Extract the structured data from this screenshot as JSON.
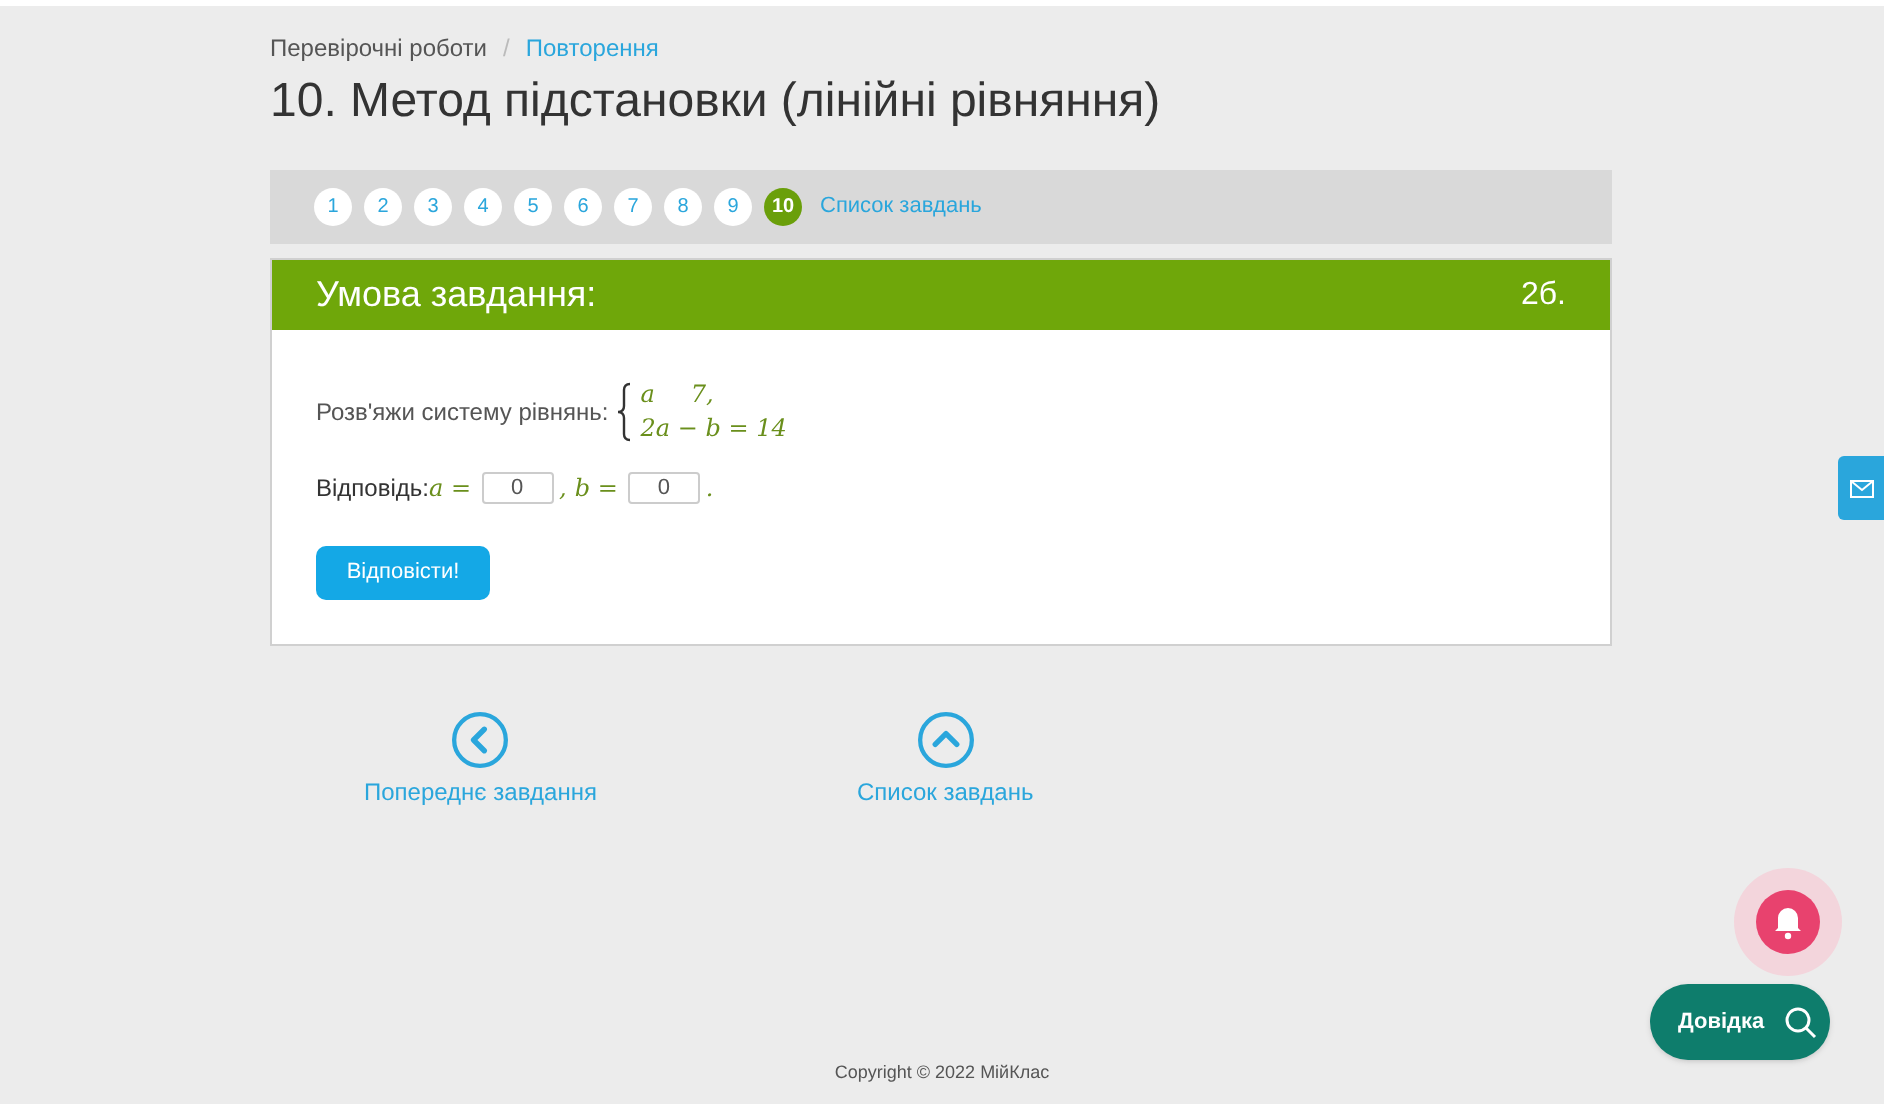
{
  "breadcrumb_separator": "/",
  "breadcrumbs": [
    {
      "label": "Перевірочні роботи",
      "link": false
    },
    {
      "label": "Повторення",
      "link": true
    }
  ],
  "title": "10. Метод підстановки (лінійні рівняння)",
  "pager": {
    "items": [
      {
        "label": "1",
        "selected": false
      },
      {
        "label": "2",
        "selected": false
      },
      {
        "label": "3",
        "selected": false
      },
      {
        "label": "4",
        "selected": false
      },
      {
        "label": "5",
        "selected": false
      },
      {
        "label": "6",
        "selected": false
      },
      {
        "label": "7",
        "selected": false
      },
      {
        "label": "8",
        "selected": false
      },
      {
        "label": "9",
        "selected": false
      },
      {
        "label": "10",
        "selected": true
      }
    ],
    "list_link": "Список завдань"
  },
  "task": {
    "header": "Умова завдання:",
    "points": "2б.",
    "prompt": "Розв'яжи систему рівнянь:",
    "system": [
      [
        "a",
        "7,"
      ],
      [
        "2a − b = 14"
      ]
    ],
    "answer_label": "Відповідь:",
    "answer": [
      {
        "var": "a =",
        "value": "0",
        "after": ","
      },
      {
        "var": "b =",
        "value": "0",
        "after": "."
      }
    ],
    "submit": "Відповісти!"
  },
  "nav": [
    {
      "kind": "previous",
      "label": "Попереднє завдання"
    },
    {
      "kind": "list",
      "label": "Список завдань"
    }
  ],
  "help_button": "Довідка",
  "footer": "Copyright © 2022 МійКлас"
}
